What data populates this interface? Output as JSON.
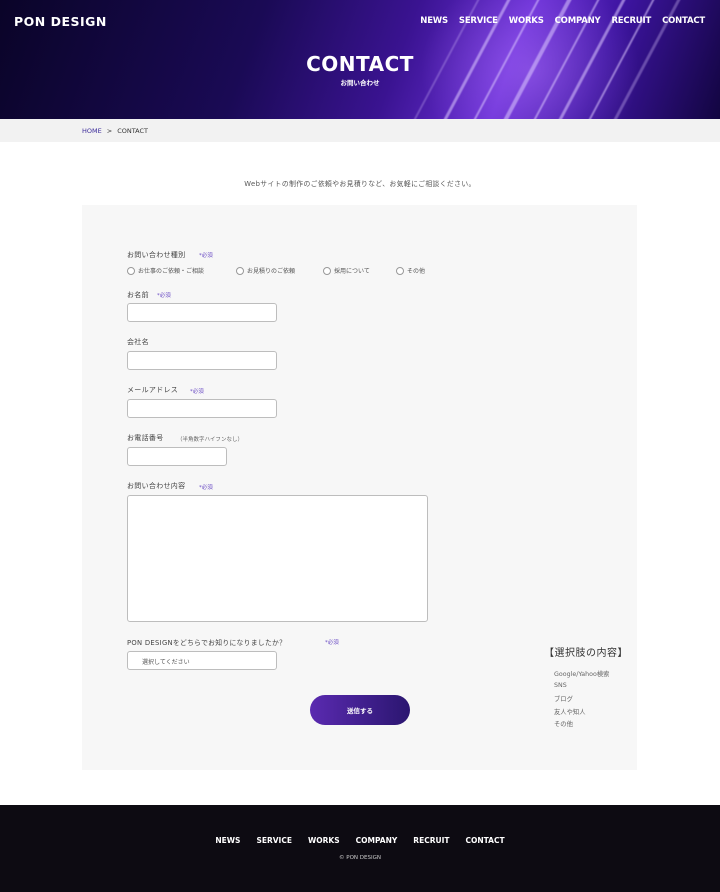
{
  "header": {
    "logo": "PON DESIGN",
    "nav": [
      "NEWS",
      "SERVICE",
      "WORKS",
      "COMPANY",
      "RECRUIT",
      "CONTACT"
    ]
  },
  "hero": {
    "title": "CONTACT",
    "subtitle": "お問い合わせ"
  },
  "breadcrumb": {
    "home": "HOME",
    "separator": ">",
    "current": "CONTACT"
  },
  "intro": "Webサイトの制作のご依頼やお見積りなど、お気軽にご相談ください。",
  "form": {
    "required_mark": "*必須",
    "inquiry_type": {
      "label": "お問い合わせ種別",
      "options": [
        "お仕事のご依頼・ご相談",
        "お見積りのご依頼",
        "採用について",
        "その他"
      ]
    },
    "name_label": "お名前",
    "company_label": "会社名",
    "email_label": "メールアドレス",
    "phone_label": "お電話番号",
    "phone_note": "（半角数字ハイフンなし）",
    "message_label": "お問い合わせ内容",
    "source_label": "PON DESIGNをどちらでお知りになりましたか？",
    "source_placeholder": "選択してください",
    "submit": "送信する"
  },
  "options_panel": {
    "title": "【選択肢の内容】",
    "items": [
      "Google/Yahoo検索",
      "SNS",
      "ブログ",
      "友人や知人",
      "その他"
    ]
  },
  "footer": {
    "nav": [
      "NEWS",
      "SERVICE",
      "WORKS",
      "COMPANY",
      "RECRUIT",
      "CONTACT"
    ],
    "copyright": "© PON DESIGN"
  },
  "colors": {
    "accent": "#5a2ab0",
    "footer_bg": "#0d0b12"
  }
}
